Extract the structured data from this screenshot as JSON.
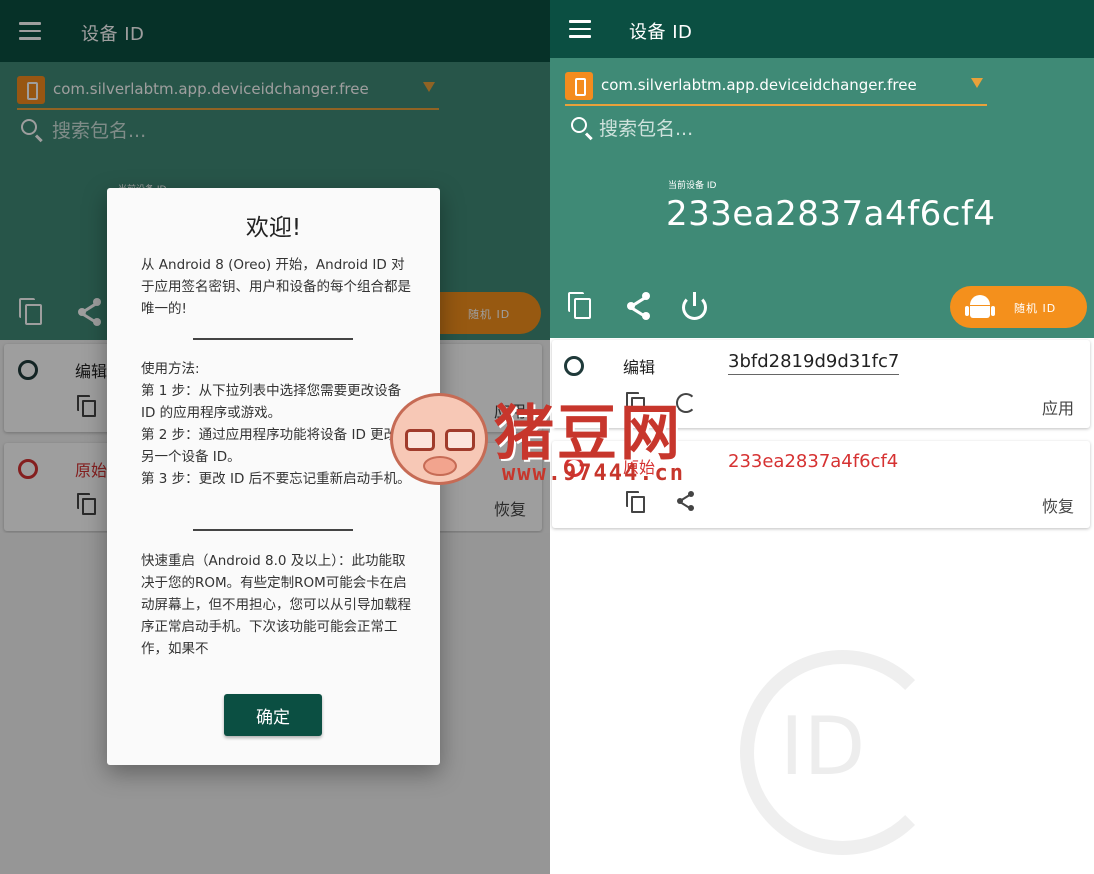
{
  "app": {
    "title": "设备 ID",
    "package": "com.silverlabtm.app.deviceidchanger.free",
    "search_placeholder": "搜索包名...",
    "current_label": "当前设备 ID",
    "current_id": "233ea2837a4f6cf4",
    "random_label": "随机 ID"
  },
  "cards": {
    "edit": {
      "label": "编辑",
      "value": "3bfd2819d9d31fc7",
      "action": "应用"
    },
    "original": {
      "label": "原始",
      "value": "233ea2837a4f6cf4",
      "action": "恢复"
    }
  },
  "dialog": {
    "title": "欢迎!",
    "para1": "从 Android 8 (Oreo) 开始，Android ID 对于应用签名密钥、用户和设备的每个组合都是唯一的!",
    "usage_title": "使用方法:",
    "step1": "第 1 步：从下拉列表中选择您需要更改设备 ID 的应用程序或游戏。",
    "step2": "第 2 步：通过应用程序功能将设备 ID 更改为另一个设备 ID。",
    "step3": "第 3 步：更改 ID 后不要忘记重新启动手机。",
    "para3": "快速重启（Android 8.0 及以上）：此功能取决于您的ROM。有些定制ROM可能会卡在启动屏幕上，但不用担心，您可以从引导加载程序正常启动手机。下次该功能可能会正常工作，如果不",
    "ok": "确定"
  },
  "background_logo": "ID",
  "watermark": {
    "brand": "猪豆网",
    "url": "www.97444.cn"
  },
  "colors": {
    "primary_dark": "#0b4f42",
    "primary": "#3f8a76",
    "accent": "#f4901c",
    "error": "#d63232"
  }
}
